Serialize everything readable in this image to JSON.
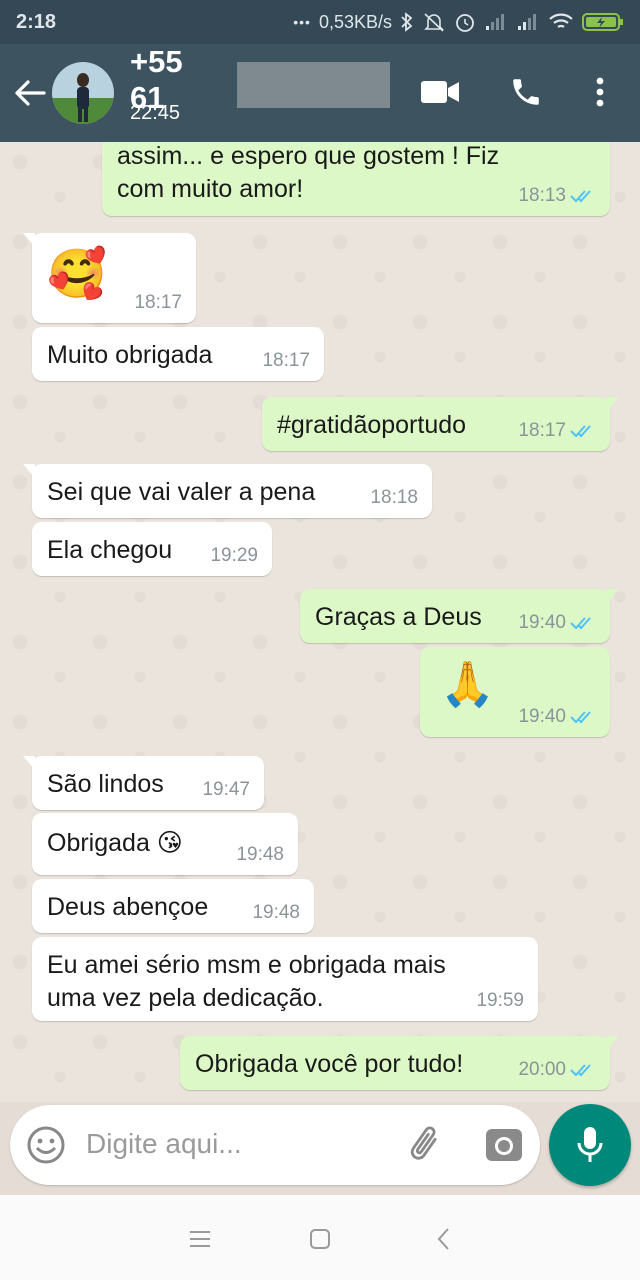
{
  "status_bar": {
    "time": "2:18",
    "dots": "•••",
    "network_speed": "0,53KB/s",
    "icons": [
      "bluetooth-icon",
      "mute-icon",
      "alarm-icon",
      "signal-icon",
      "signal-icon",
      "wifi-icon",
      "battery-charging-icon"
    ]
  },
  "header": {
    "contact_name": "+55 61",
    "subtitle": "22:45"
  },
  "messages": [
    {
      "dir": "out",
      "text": "assim... e espero que gostem ! Fiz\ncom muito amor!",
      "time": "18:13",
      "read": true
    },
    {
      "dir": "in",
      "text": "🥰",
      "time": "18:17"
    },
    {
      "dir": "in",
      "text": "Muito obrigada",
      "time": "18:17"
    },
    {
      "dir": "out",
      "text": "#gratidãoportudo",
      "time": "18:17",
      "read": true
    },
    {
      "dir": "in",
      "text": "Sei que vai valer a pena",
      "time": "18:18"
    },
    {
      "dir": "in",
      "text": "Ela chegou",
      "time": "19:29"
    },
    {
      "dir": "out",
      "text": "Graças a Deus",
      "time": "19:40",
      "read": true
    },
    {
      "dir": "out",
      "text": "🙏",
      "time": "19:40",
      "read": true
    },
    {
      "dir": "in",
      "text": "São lindos",
      "time": "19:47"
    },
    {
      "dir": "in",
      "text": "Obrigada 😘",
      "time": "19:48"
    },
    {
      "dir": "in",
      "text": "Deus abençoe",
      "time": "19:48"
    },
    {
      "dir": "in",
      "text": "Eu amei sério msm e obrigada mais\numa vez pela dedicação.",
      "time": "19:59"
    },
    {
      "dir": "out",
      "text": "Obrigada você por tudo!",
      "time": "20:00",
      "read": true
    }
  ],
  "input": {
    "placeholder": "Digite aqui..."
  },
  "colors": {
    "header": "#3d535f",
    "status_bar": "#344955",
    "outgoing_bubble": "#dcf8c6",
    "incoming_bubble": "#ffffff",
    "read_ticks": "#4fc3f7",
    "mic_button": "#00897b",
    "chat_background": "#ebe4dc"
  }
}
